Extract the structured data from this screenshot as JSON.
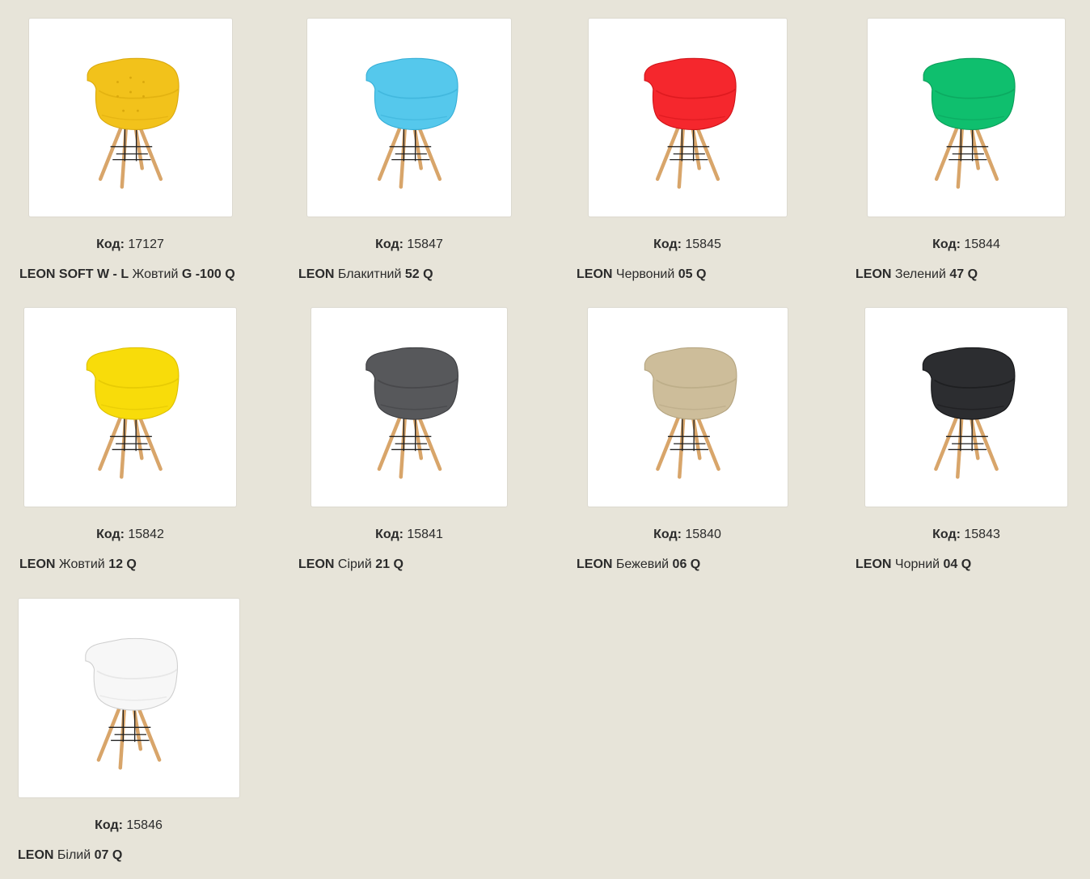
{
  "code_label": "Код:",
  "products": [
    {
      "code": "17127",
      "name_a": "LEON SOFT W - L",
      "name_b": " Жовтий ",
      "name_c": "G -100 Q",
      "seat": "#f2c21b",
      "seat_dark": "#d9a80c",
      "quilted": true
    },
    {
      "code": "15847",
      "name_a": "LEON",
      "name_b": " Блакитний ",
      "name_c": "52 Q",
      "seat": "#55c8ec",
      "seat_dark": "#35aed6",
      "quilted": false
    },
    {
      "code": "15845",
      "name_a": "LEON",
      "name_b": " Червоний ",
      "name_c": "05 Q",
      "seat": "#f5272d",
      "seat_dark": "#cf1217",
      "quilted": false
    },
    {
      "code": "15844",
      "name_a": "LEON",
      "name_b": " Зелений ",
      "name_c": "47 Q",
      "seat": "#0fbf6e",
      "seat_dark": "#0a9d59",
      "quilted": false
    },
    {
      "code": "15842",
      "name_a": "LEON",
      "name_b": " Жовтий ",
      "name_c": "12 Q",
      "seat": "#f8dc0a",
      "seat_dark": "#dcbf00",
      "quilted": false
    },
    {
      "code": "15841",
      "name_a": "LEON",
      "name_b": " Сірий ",
      "name_c": "21 Q",
      "seat": "#57585b",
      "seat_dark": "#3d3e41",
      "quilted": false
    },
    {
      "code": "15840",
      "name_a": "LEON",
      "name_b": " Бежевий ",
      "name_c": "06 Q",
      "seat": "#cdbd9a",
      "seat_dark": "#b3a37f",
      "quilted": false
    },
    {
      "code": "15843",
      "name_a": "LEON",
      "name_b": " Чорний ",
      "name_c": "04 Q",
      "seat": "#2c2d30",
      "seat_dark": "#151618",
      "quilted": false
    },
    {
      "code": "15846",
      "name_a": "LEON",
      "name_b": " Білий ",
      "name_c": "07 Q",
      "seat": "#f7f7f7",
      "seat_dark": "#dcdcdc",
      "quilted": false
    }
  ]
}
